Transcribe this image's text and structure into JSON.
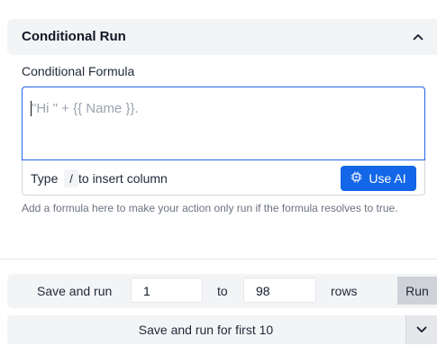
{
  "section": {
    "title": "Conditional Run",
    "collapse_icon": "chevron-up-icon"
  },
  "formula": {
    "label": "Conditional Formula",
    "placeholder": "\"Hi \" + {{ Name }}.",
    "hint_prefix": "Type",
    "hint_key": "/",
    "hint_suffix": "to insert column",
    "use_ai_label": "Use AI",
    "use_ai_icon": "sparkle-chip-icon",
    "helper_text": "Add a formula here to make your action only run if the formula resolves to true."
  },
  "run_range": {
    "save_and_run_label": "Save and run",
    "from_value": "1",
    "to_label": "to",
    "to_value": "98",
    "rows_label": "rows",
    "run_button_label": "Run"
  },
  "save_first": {
    "label": "Save and run for first 10",
    "dropdown_icon": "chevron-down-icon"
  },
  "colors": {
    "accent": "#1366e8",
    "focus_border": "#2563eb",
    "panel_bg": "#f3f4f6"
  }
}
